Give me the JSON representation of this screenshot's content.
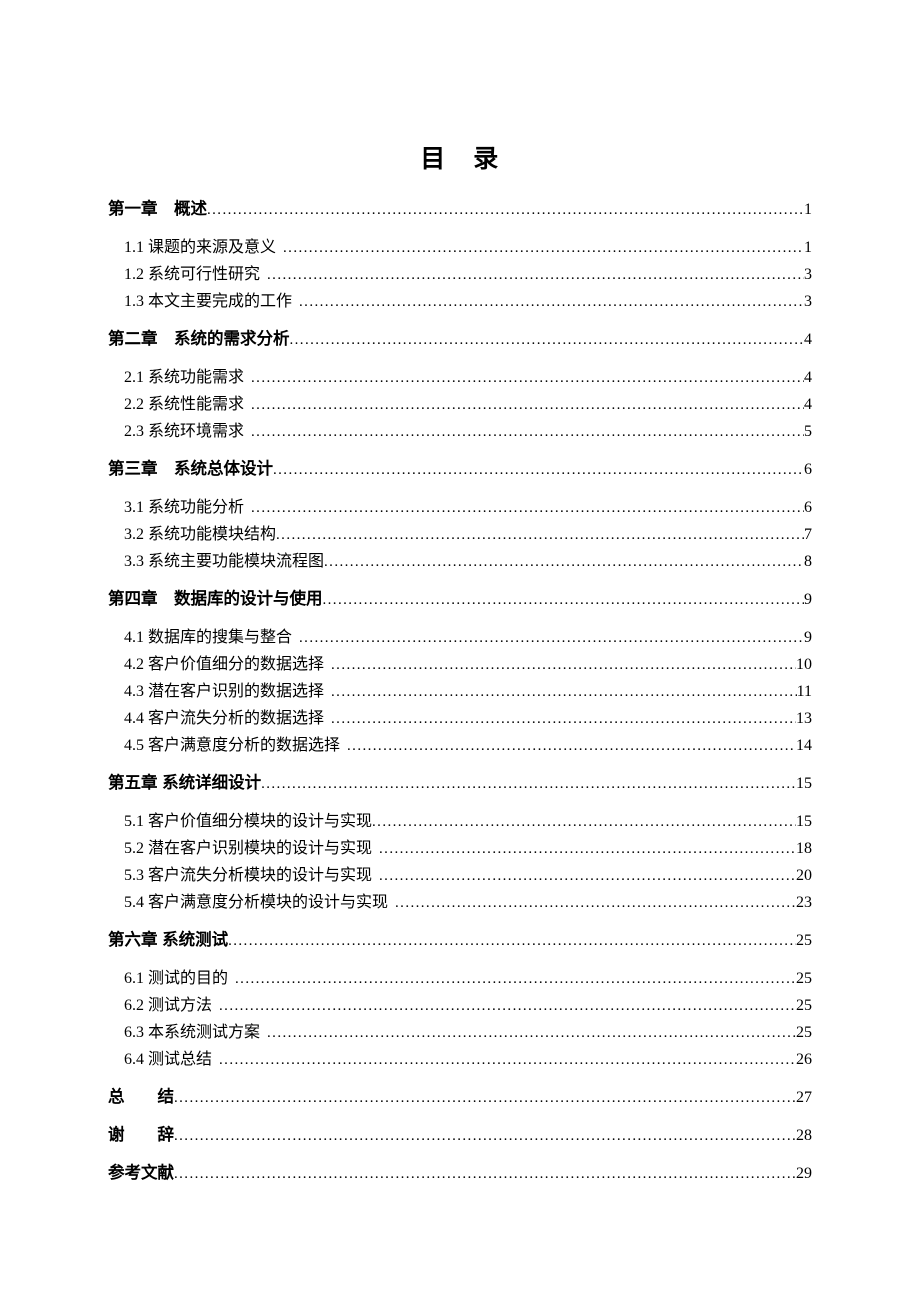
{
  "document": {
    "title": "目　录",
    "type": "table-of-contents"
  },
  "toc": {
    "entries": [
      {
        "label": "第一章　概述",
        "page": "1",
        "level": 1,
        "gap_before": false,
        "pre_space": false
      },
      {
        "label": "1.1 课题的来源及意义",
        "page": "1",
        "level": 2,
        "gap_before": true,
        "pre_space": true
      },
      {
        "label": "1.2 系统可行性研究",
        "page": "3",
        "level": 2,
        "gap_before": false,
        "pre_space": true
      },
      {
        "label": "1.3 本文主要完成的工作",
        "page": "3",
        "level": 2,
        "gap_before": false,
        "pre_space": true
      },
      {
        "label": "第二章　系统的需求分析",
        "page": "4",
        "level": 1,
        "gap_before": true,
        "pre_space": false
      },
      {
        "label": "2.1 系统功能需求",
        "page": "4",
        "level": 2,
        "gap_before": true,
        "pre_space": true
      },
      {
        "label": "2.2 系统性能需求",
        "page": "4",
        "level": 2,
        "gap_before": false,
        "pre_space": true
      },
      {
        "label": "2.3 系统环境需求",
        "page": "5",
        "level": 2,
        "gap_before": false,
        "pre_space": true
      },
      {
        "label": "第三章　系统总体设计",
        "page": "6",
        "level": 1,
        "gap_before": true,
        "pre_space": false
      },
      {
        "label": "3.1 系统功能分析",
        "page": "6",
        "level": 2,
        "gap_before": true,
        "pre_space": true
      },
      {
        "label": "3.2 系统功能模块结构",
        "page": "7",
        "level": 2,
        "gap_before": false,
        "pre_space": false
      },
      {
        "label": "3.3 系统主要功能模块流程图",
        "page": "8",
        "level": 2,
        "gap_before": false,
        "pre_space": false
      },
      {
        "label": "第四章　数据库的设计与使用",
        "page": "9",
        "level": 1,
        "gap_before": true,
        "pre_space": false
      },
      {
        "label": "4.1 数据库的搜集与整合",
        "page": "9",
        "level": 2,
        "gap_before": true,
        "pre_space": true
      },
      {
        "label": "4.2 客户价值细分的数据选择",
        "page": "10",
        "level": 2,
        "gap_before": false,
        "pre_space": true
      },
      {
        "label": "4.3 潜在客户识别的数据选择",
        "page": "11",
        "level": 2,
        "gap_before": false,
        "pre_space": true
      },
      {
        "label": "4.4 客户流失分析的数据选择",
        "page": "13",
        "level": 2,
        "gap_before": false,
        "pre_space": true
      },
      {
        "label": "4.5 客户满意度分析的数据选择",
        "page": "14",
        "level": 2,
        "gap_before": false,
        "pre_space": true
      },
      {
        "label": "第五章 系统详细设计",
        "page": "15",
        "level": 1,
        "gap_before": true,
        "pre_space": false
      },
      {
        "label": "5.1 客户价值细分模块的设计与实现",
        "page": "15",
        "level": 2,
        "gap_before": true,
        "pre_space": false
      },
      {
        "label": "5.2 潜在客户识别模块的设计与实现",
        "page": "18",
        "level": 2,
        "gap_before": false,
        "pre_space": true
      },
      {
        "label": "5.3 客户流失分析模块的设计与实现",
        "page": "20",
        "level": 2,
        "gap_before": false,
        "pre_space": true
      },
      {
        "label": "5.4 客户满意度分析模块的设计与实现",
        "page": "23",
        "level": 2,
        "gap_before": false,
        "pre_space": true
      },
      {
        "label": "第六章 系统测试",
        "page": "25",
        "level": 1,
        "gap_before": true,
        "pre_space": false
      },
      {
        "label": "6.1 测试的目的",
        "page": "25",
        "level": 2,
        "gap_before": true,
        "pre_space": true
      },
      {
        "label": "6.2 测试方法",
        "page": "25",
        "level": 2,
        "gap_before": false,
        "pre_space": true
      },
      {
        "label": "6.3 本系统测试方案",
        "page": "25",
        "level": 2,
        "gap_before": false,
        "pre_space": true
      },
      {
        "label": "6.4 测试总结",
        "page": "26",
        "level": 2,
        "gap_before": false,
        "pre_space": true
      },
      {
        "label": "总　　结",
        "page": "27",
        "level": "back",
        "gap_before": true,
        "pre_space": false
      },
      {
        "label": "谢　　辞",
        "page": "28",
        "level": "back",
        "gap_before": true,
        "pre_space": false
      },
      {
        "label": "参考文献",
        "page": "29",
        "level": "back",
        "gap_before": true,
        "pre_space": false
      }
    ]
  }
}
